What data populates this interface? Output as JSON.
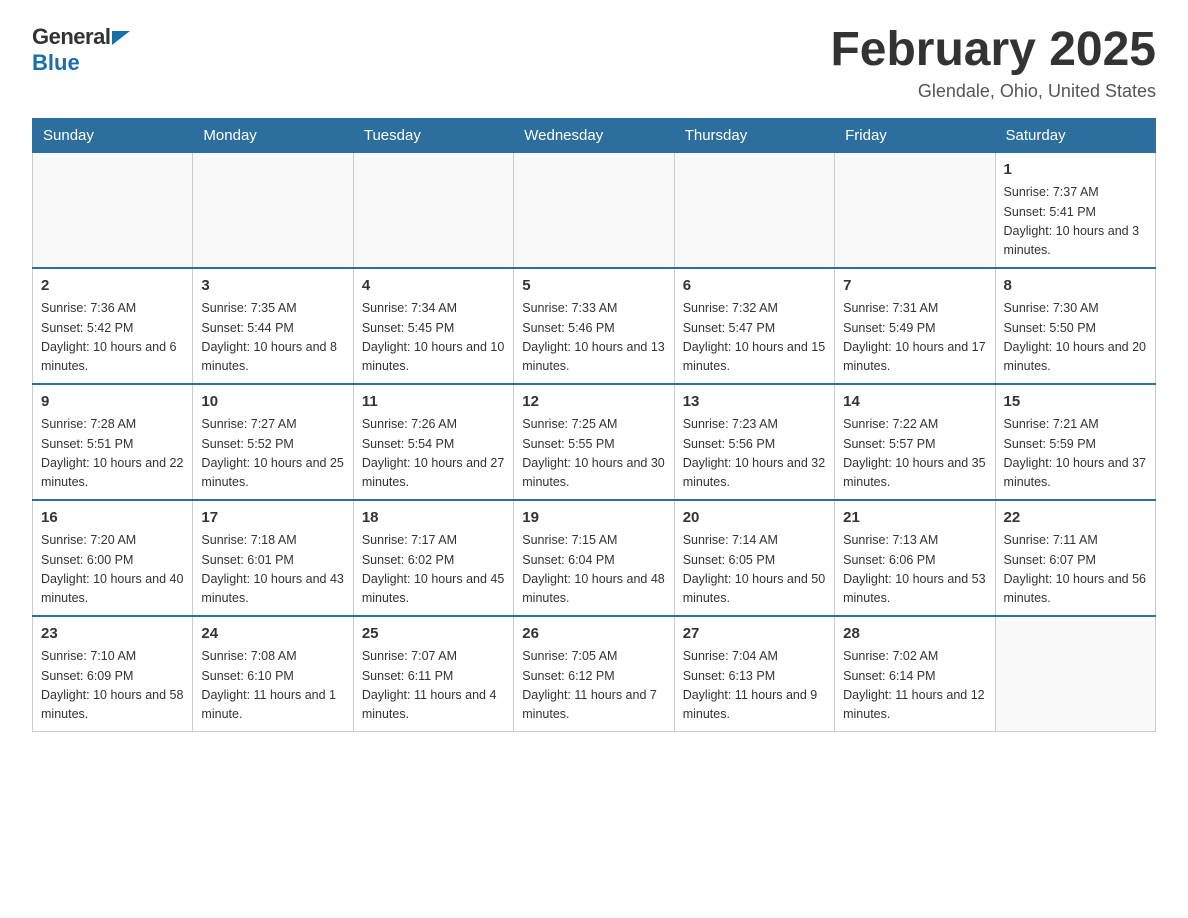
{
  "logo": {
    "general": "General",
    "blue": "Blue"
  },
  "title": "February 2025",
  "location": "Glendale, Ohio, United States",
  "days_of_week": [
    "Sunday",
    "Monday",
    "Tuesday",
    "Wednesday",
    "Thursday",
    "Friday",
    "Saturday"
  ],
  "weeks": [
    [
      {
        "day": "",
        "info": ""
      },
      {
        "day": "",
        "info": ""
      },
      {
        "day": "",
        "info": ""
      },
      {
        "day": "",
        "info": ""
      },
      {
        "day": "",
        "info": ""
      },
      {
        "day": "",
        "info": ""
      },
      {
        "day": "1",
        "info": "Sunrise: 7:37 AM\nSunset: 5:41 PM\nDaylight: 10 hours and 3 minutes."
      }
    ],
    [
      {
        "day": "2",
        "info": "Sunrise: 7:36 AM\nSunset: 5:42 PM\nDaylight: 10 hours and 6 minutes."
      },
      {
        "day": "3",
        "info": "Sunrise: 7:35 AM\nSunset: 5:44 PM\nDaylight: 10 hours and 8 minutes."
      },
      {
        "day": "4",
        "info": "Sunrise: 7:34 AM\nSunset: 5:45 PM\nDaylight: 10 hours and 10 minutes."
      },
      {
        "day": "5",
        "info": "Sunrise: 7:33 AM\nSunset: 5:46 PM\nDaylight: 10 hours and 13 minutes."
      },
      {
        "day": "6",
        "info": "Sunrise: 7:32 AM\nSunset: 5:47 PM\nDaylight: 10 hours and 15 minutes."
      },
      {
        "day": "7",
        "info": "Sunrise: 7:31 AM\nSunset: 5:49 PM\nDaylight: 10 hours and 17 minutes."
      },
      {
        "day": "8",
        "info": "Sunrise: 7:30 AM\nSunset: 5:50 PM\nDaylight: 10 hours and 20 minutes."
      }
    ],
    [
      {
        "day": "9",
        "info": "Sunrise: 7:28 AM\nSunset: 5:51 PM\nDaylight: 10 hours and 22 minutes."
      },
      {
        "day": "10",
        "info": "Sunrise: 7:27 AM\nSunset: 5:52 PM\nDaylight: 10 hours and 25 minutes."
      },
      {
        "day": "11",
        "info": "Sunrise: 7:26 AM\nSunset: 5:54 PM\nDaylight: 10 hours and 27 minutes."
      },
      {
        "day": "12",
        "info": "Sunrise: 7:25 AM\nSunset: 5:55 PM\nDaylight: 10 hours and 30 minutes."
      },
      {
        "day": "13",
        "info": "Sunrise: 7:23 AM\nSunset: 5:56 PM\nDaylight: 10 hours and 32 minutes."
      },
      {
        "day": "14",
        "info": "Sunrise: 7:22 AM\nSunset: 5:57 PM\nDaylight: 10 hours and 35 minutes."
      },
      {
        "day": "15",
        "info": "Sunrise: 7:21 AM\nSunset: 5:59 PM\nDaylight: 10 hours and 37 minutes."
      }
    ],
    [
      {
        "day": "16",
        "info": "Sunrise: 7:20 AM\nSunset: 6:00 PM\nDaylight: 10 hours and 40 minutes."
      },
      {
        "day": "17",
        "info": "Sunrise: 7:18 AM\nSunset: 6:01 PM\nDaylight: 10 hours and 43 minutes."
      },
      {
        "day": "18",
        "info": "Sunrise: 7:17 AM\nSunset: 6:02 PM\nDaylight: 10 hours and 45 minutes."
      },
      {
        "day": "19",
        "info": "Sunrise: 7:15 AM\nSunset: 6:04 PM\nDaylight: 10 hours and 48 minutes."
      },
      {
        "day": "20",
        "info": "Sunrise: 7:14 AM\nSunset: 6:05 PM\nDaylight: 10 hours and 50 minutes."
      },
      {
        "day": "21",
        "info": "Sunrise: 7:13 AM\nSunset: 6:06 PM\nDaylight: 10 hours and 53 minutes."
      },
      {
        "day": "22",
        "info": "Sunrise: 7:11 AM\nSunset: 6:07 PM\nDaylight: 10 hours and 56 minutes."
      }
    ],
    [
      {
        "day": "23",
        "info": "Sunrise: 7:10 AM\nSunset: 6:09 PM\nDaylight: 10 hours and 58 minutes."
      },
      {
        "day": "24",
        "info": "Sunrise: 7:08 AM\nSunset: 6:10 PM\nDaylight: 11 hours and 1 minute."
      },
      {
        "day": "25",
        "info": "Sunrise: 7:07 AM\nSunset: 6:11 PM\nDaylight: 11 hours and 4 minutes."
      },
      {
        "day": "26",
        "info": "Sunrise: 7:05 AM\nSunset: 6:12 PM\nDaylight: 11 hours and 7 minutes."
      },
      {
        "day": "27",
        "info": "Sunrise: 7:04 AM\nSunset: 6:13 PM\nDaylight: 11 hours and 9 minutes."
      },
      {
        "day": "28",
        "info": "Sunrise: 7:02 AM\nSunset: 6:14 PM\nDaylight: 11 hours and 12 minutes."
      },
      {
        "day": "",
        "info": ""
      }
    ]
  ]
}
